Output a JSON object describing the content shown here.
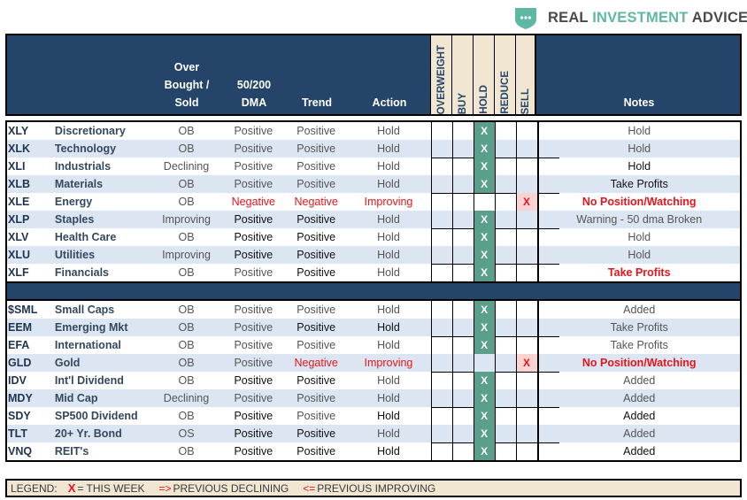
{
  "brand": {
    "name_part1": "REAL ",
    "name_part2": "INVESTMENT",
    "name_part3": " ADVICE",
    "accent_color": "#5fb8a4",
    "icon": "shield-dots-icon"
  },
  "header": {
    "ob_line1": "Over",
    "ob_line2": "Bought /",
    "ob_line3": "Sold",
    "dma_line1": "50/200",
    "dma_line2": "DMA",
    "trend": "Trend",
    "action": "Action",
    "overweight": "OVERWEIGHT",
    "buy": "BUY",
    "hold": "HOLD",
    "reduce": "REDUCE",
    "sell": "SELL",
    "notes": "Notes"
  },
  "colors": {
    "navy": "#244469",
    "tan": "#f1e6d2",
    "hold_green": "#5a9e8c",
    "sell_pink": "#f9d2d2",
    "alert_red": "#e8141a",
    "row_alt": "#dce6f2"
  },
  "mark": "X",
  "sectors": [
    {
      "ticker": "XLY",
      "name": "Discretionary",
      "ob": "OB",
      "dma": "Positive",
      "trend": "Positive",
      "action": "Hold",
      "position": "hold",
      "notes": "Hold"
    },
    {
      "ticker": "XLK",
      "name": "Technology",
      "ob": "OB",
      "dma": "Positive",
      "trend": "Positive",
      "action": "Hold",
      "position": "hold",
      "notes": "Hold"
    },
    {
      "ticker": "XLI",
      "name": "Industrials",
      "ob": "Declining",
      "dma": "Positive",
      "trend": "Positive",
      "action": "Hold",
      "position": "hold",
      "notes": "Hold"
    },
    {
      "ticker": "XLB",
      "name": "Materials",
      "ob": "OB",
      "dma": "Positive",
      "trend": "Positive",
      "action": "Hold",
      "position": "hold",
      "notes": "Take Profits"
    },
    {
      "ticker": "XLE",
      "name": "Energy",
      "ob": "OB",
      "dma": "Negative",
      "trend": "Negative",
      "action": "Improving",
      "position": "sell",
      "notes": "No Position/Watching"
    },
    {
      "ticker": "XLP",
      "name": "Staples",
      "ob": "Improving",
      "dma": "Positive",
      "trend": "Positive",
      "action": "Hold",
      "position": "hold",
      "notes": "Warning - 50 dma Broken"
    },
    {
      "ticker": "XLV",
      "name": "Health Care",
      "ob": "OB",
      "dma": "Positive",
      "trend": "Positive",
      "action": "Hold",
      "position": "hold",
      "notes": "Hold"
    },
    {
      "ticker": "XLU",
      "name": "Utilities",
      "ob": "Improving",
      "dma": "Positive",
      "trend": "Positive",
      "action": "Hold",
      "position": "hold",
      "notes": "Hold"
    },
    {
      "ticker": "XLF",
      "name": "Financials",
      "ob": "OB",
      "dma": "Positive",
      "trend": "Positive",
      "action": "Hold",
      "position": "hold",
      "notes": "Take Profits"
    }
  ],
  "markets": [
    {
      "ticker": "$SML",
      "name": "Small Caps",
      "ob": "OB",
      "dma": "Positive",
      "trend": "Positive",
      "action": "Hold",
      "position": "hold",
      "notes": "Added"
    },
    {
      "ticker": "EEM",
      "name": "Emerging Mkt",
      "ob": "OB",
      "dma": "Positive",
      "trend": "Positive",
      "action": "Hold",
      "position": "hold",
      "notes": "Take Profits"
    },
    {
      "ticker": "EFA",
      "name": "International",
      "ob": "OB",
      "dma": "Positive",
      "trend": "Positive",
      "action": "Hold",
      "position": "hold",
      "notes": "Take Profits"
    },
    {
      "ticker": "GLD",
      "name": "Gold",
      "ob": "OB",
      "dma": "Positive",
      "trend": "Negative",
      "action": "Improving",
      "position": "sell",
      "notes": "No Position/Watching"
    },
    {
      "ticker": "IDV",
      "name": "Int'l Dividend",
      "ob": "OB",
      "dma": "Positive",
      "trend": "Positive",
      "action": "Hold",
      "position": "hold",
      "notes": "Added"
    },
    {
      "ticker": "MDY",
      "name": "Mid Cap",
      "ob": "Declining",
      "dma": "Positive",
      "trend": "Positive",
      "action": "Hold",
      "position": "hold",
      "notes": "Added"
    },
    {
      "ticker": "SDY",
      "name": "SP500 Dividend",
      "ob": "OB",
      "dma": "Positive",
      "trend": "Positive",
      "action": "Hold",
      "position": "hold",
      "notes": "Added"
    },
    {
      "ticker": "TLT",
      "name": "20+ Yr. Bond",
      "ob": "OS",
      "dma": "Positive",
      "trend": "Positive",
      "action": "Hold",
      "position": "hold",
      "notes": "Added"
    },
    {
      "ticker": "VNQ",
      "name": "REIT's",
      "ob": "OB",
      "dma": "Positive",
      "trend": "Positive",
      "action": "Hold",
      "position": "hold",
      "notes": "Added"
    }
  ],
  "legend": {
    "label": "LEGEND:",
    "x_symbol": "X",
    "x_text": "= THIS WEEK",
    "declining_symbol": "=>",
    "declining_text": "PREVIOUS DECLINING",
    "improving_symbol": "<=",
    "improving_text": "PREVIOUS IMPROVING"
  }
}
